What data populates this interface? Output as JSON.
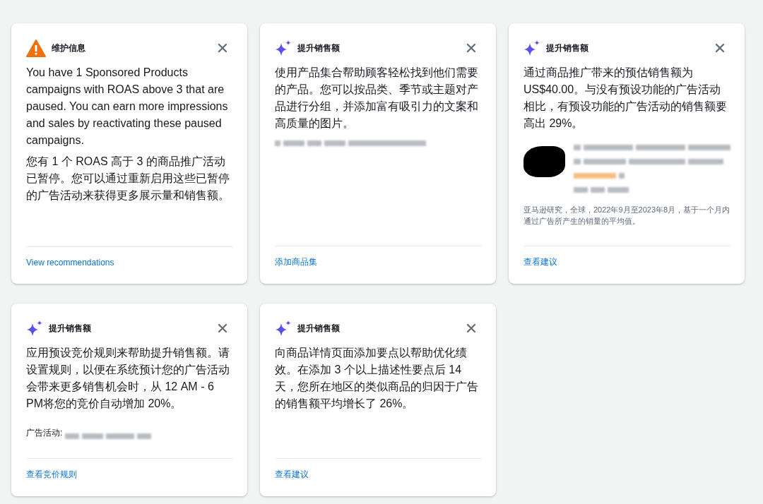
{
  "cards": [
    {
      "kind": "warning",
      "title": "维护信息",
      "paragraphs": [
        "You have 1 Sponsored Products campaigns with ROAS above 3 that are paused. You can earn more impressions and sales by reactivating these paused campaigns.",
        "您有 1 个 ROAS 高于 3 的商品推广活动已暂停。您可以通过重新启用这些已暂停的广告活动来获得更多展示量和销售额。"
      ],
      "link": "View recommendations"
    },
    {
      "kind": "sparkle",
      "title": "提升销售额",
      "paragraphs": [
        "使用产品集合帮助顾客轻松找到他们需要的产品。您可以按品类、季节或主题对产品进行分组，并添加富有吸引力的文案和高质量的图片。"
      ],
      "blurred_line": true,
      "link": "添加商品集"
    },
    {
      "kind": "sparkle",
      "title": "提升销售额",
      "paragraphs": [
        "通过商品推广带来的预估销售额为 US$40.00。与没有预设功能的广告活动相比，有预设功能的广告活动的销售额要高出 29%。"
      ],
      "redacted_product": true,
      "note": "亚马逊研究，全球，2022年9月至2023年8月，基于一个月内通过广告所产生的销量的平均值。",
      "link": "查看建议"
    },
    {
      "kind": "sparkle",
      "title": "提升销售额",
      "paragraphs": [
        "应用预设竞价规则来帮助提升销售额。请设置规则，以便在系统预计您的广告活动会带来更多销售机会时，从 12 AM - 6 PM将您的竞价自动增加 20%。"
      ],
      "campaign_label": "广告活动:",
      "link": "查看竞价规则"
    },
    {
      "kind": "sparkle",
      "title": "提升销售额",
      "paragraphs": [
        "向商品详情页面添加要点以帮助优化绩效。在添加 3 个以上描述性要点后 14 天，您所在地区的类似商品的归因于广告的销售额平均增长了 26%。"
      ],
      "link": "查看建议"
    }
  ]
}
